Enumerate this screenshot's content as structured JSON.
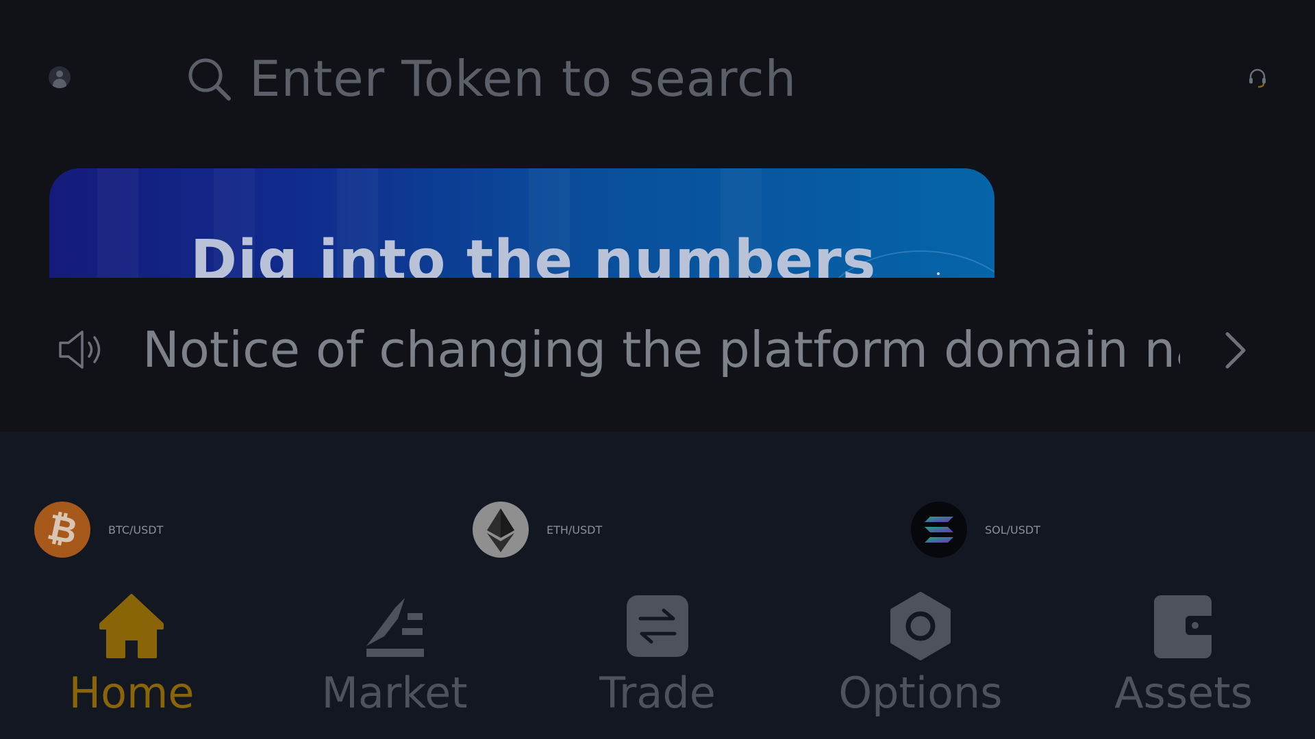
{
  "header": {
    "avatar_icon": "user-avatar-icon",
    "search": {
      "placeholder": "Enter Token to search",
      "icon": "search-icon"
    },
    "support_icon": "headset-icon"
  },
  "banner": {
    "headline": "Dig into the numbers"
  },
  "notice": {
    "icon": "speaker-icon",
    "text": "Notice of changing the platform domain nam",
    "chevron": "chevron-right-icon"
  },
  "pairs": [
    {
      "label": "BTC/USDT",
      "icon": "bitcoin-icon",
      "color": "#a7591c"
    },
    {
      "label": "ETH/USDT",
      "icon": "ethereum-icon",
      "color": "#8f8f8f"
    },
    {
      "label": "SOL/USDT",
      "icon": "solana-icon",
      "color": "#07080c"
    }
  ],
  "nav": {
    "active": "Home",
    "active_color": "#8a6508",
    "tabs": [
      {
        "label": "Home",
        "icon": "home-icon"
      },
      {
        "label": "Market",
        "icon": "market-icon"
      },
      {
        "label": "Trade",
        "icon": "trade-icon"
      },
      {
        "label": "Options",
        "icon": "options-icon"
      },
      {
        "label": "Assets",
        "icon": "wallet-icon"
      }
    ]
  }
}
